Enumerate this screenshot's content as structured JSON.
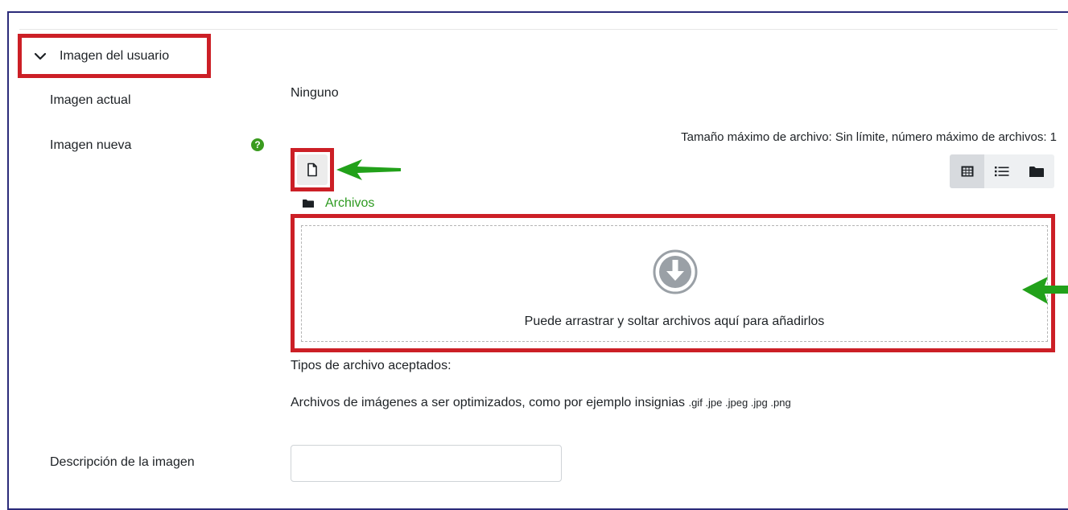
{
  "section": {
    "title": "Imagen del usuario",
    "chevron_icon": "chevron-down-icon"
  },
  "fields": {
    "current_image": {
      "label": "Imagen actual",
      "value": "Ninguno"
    },
    "new_image": {
      "label": "Imagen nueva",
      "help_icon": "help-icon"
    },
    "description": {
      "label": "Descripción de la imagen",
      "value": ""
    }
  },
  "filepicker": {
    "max_size_text": "Tamaño máximo de archivo: Sin límite, número máximo de archivos: 1",
    "add_file_icon": "file-icon",
    "views": [
      "grid-view-icon",
      "list-view-icon",
      "folder-view-icon"
    ],
    "active_view": "grid-view-icon",
    "path_folder_icon": "folder-icon",
    "path_label": "Archivos",
    "drop_text": "Puede arrastrar y soltar archivos aquí para añadirlos",
    "drop_icon": "download-circle-icon"
  },
  "accepted_types": {
    "title": "Tipos de archivo aceptados:",
    "description": "Archivos de imágenes a ser optimizados, como por ejemplo insignias",
    "extensions": ".gif .jpe .jpeg .jpg .png"
  },
  "colors": {
    "highlight_red": "#cc1f26",
    "arrow_green": "#22a11a",
    "link_green": "#2d9a20",
    "help_green": "#3a9b1f"
  }
}
